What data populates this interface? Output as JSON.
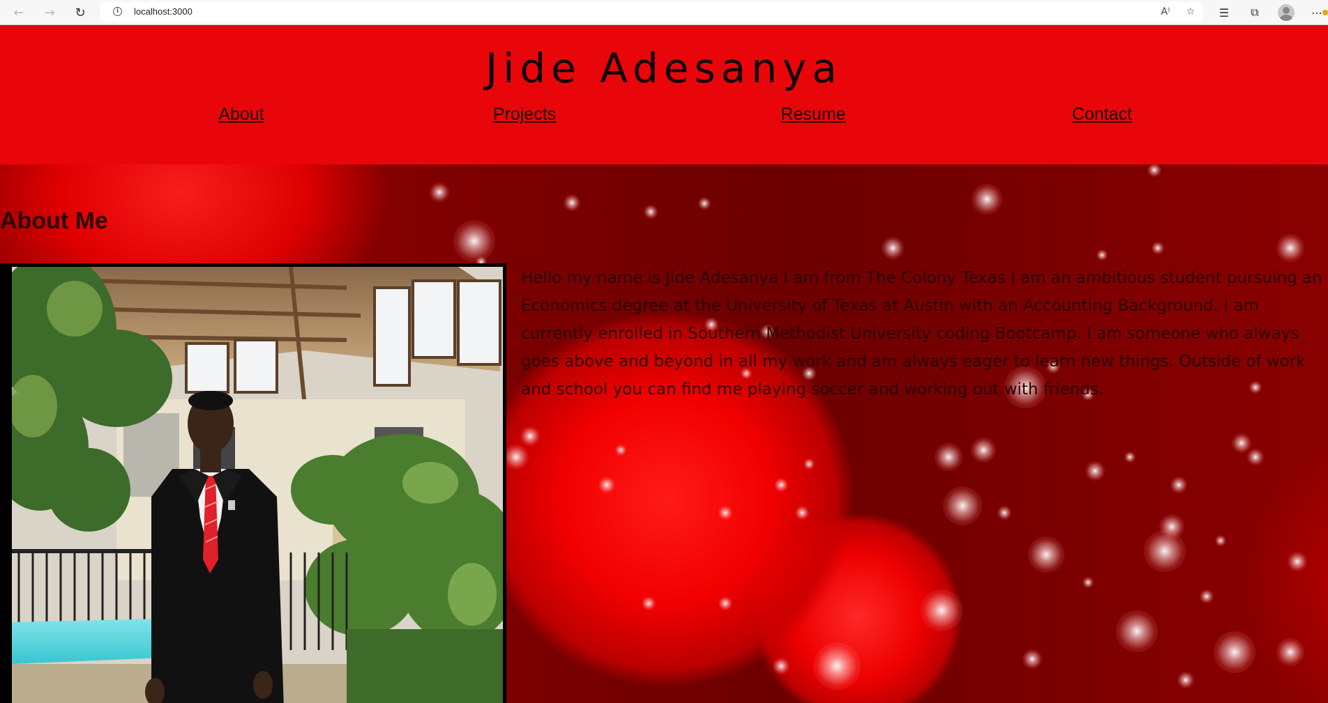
{
  "browser": {
    "url": "localhost:3000"
  },
  "site": {
    "title": "Jide Adesanya",
    "nav": [
      "About",
      "Projects",
      "Resume",
      "Contact"
    ]
  },
  "about": {
    "heading": "About Me",
    "photo_alt": "Jide Adesanya",
    "text": "Hello my name is Jide Adesanya I am from The Colony Texas I am an ambitious student pursuing an Economics degree at the University of Texas at Austin with an Accounting Background. I am currently enrolled in Southern Methodist University coding Bootcamp. I am someone who always goes above and beyond in all my work and am always eager to learn new things. Outside of work and school you can find me playing soccer and working out with friends."
  },
  "colors": {
    "header": "#e8060a",
    "background": "#7a0000",
    "text": "#2b0000"
  }
}
